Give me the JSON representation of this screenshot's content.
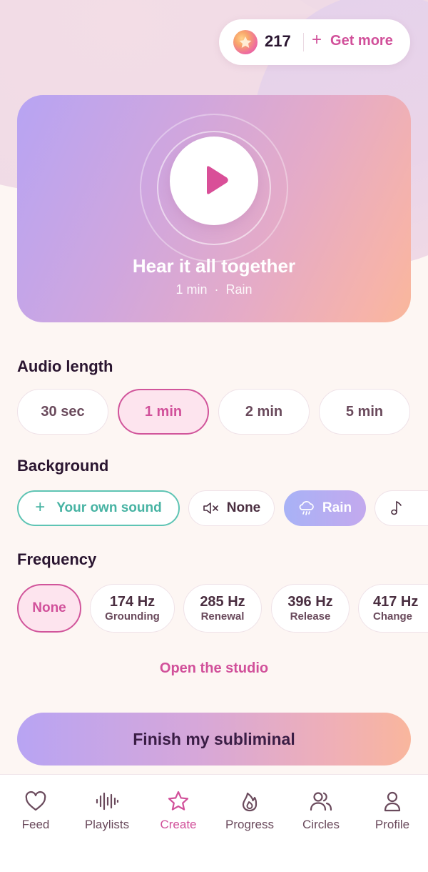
{
  "credits": {
    "count": "217",
    "get_more_label": "Get more"
  },
  "hero": {
    "title": "Hear it all together",
    "length": "1 min",
    "separator": "·",
    "background": "Rain"
  },
  "audio_length": {
    "title": "Audio length",
    "options": [
      "30 sec",
      "1 min",
      "2 min",
      "5 min"
    ],
    "selected": "1 min"
  },
  "background": {
    "title": "Background",
    "own_sound_label": "Your own sound",
    "options": [
      {
        "label": "None",
        "icon": "speaker-mute-icon"
      },
      {
        "label": "Rain",
        "icon": "rain-cloud-icon",
        "selected": true
      },
      {
        "label": "",
        "icon": "music-note-icon"
      }
    ]
  },
  "frequency": {
    "title": "Frequency",
    "options": [
      {
        "hz": "None",
        "name": "",
        "selected": true
      },
      {
        "hz": "174 Hz",
        "name": "Grounding"
      },
      {
        "hz": "285 Hz",
        "name": "Renewal"
      },
      {
        "hz": "396 Hz",
        "name": "Release"
      },
      {
        "hz": "417 Hz",
        "name": "Change"
      }
    ]
  },
  "open_studio_label": "Open the studio",
  "finish_label": "Finish my subliminal",
  "nav": {
    "items": [
      {
        "label": "Feed",
        "icon": "heart-icon"
      },
      {
        "label": "Playlists",
        "icon": "waveform-icon"
      },
      {
        "label": "Create",
        "icon": "star-icon",
        "active": true
      },
      {
        "label": "Progress",
        "icon": "flame-icon"
      },
      {
        "label": "Circles",
        "icon": "people-icon"
      },
      {
        "label": "Profile",
        "icon": "person-icon"
      }
    ]
  },
  "colors": {
    "accent": "#d1509a",
    "teal": "#47b3a3",
    "text": "#2a1530",
    "background": "#fdf6f3"
  }
}
